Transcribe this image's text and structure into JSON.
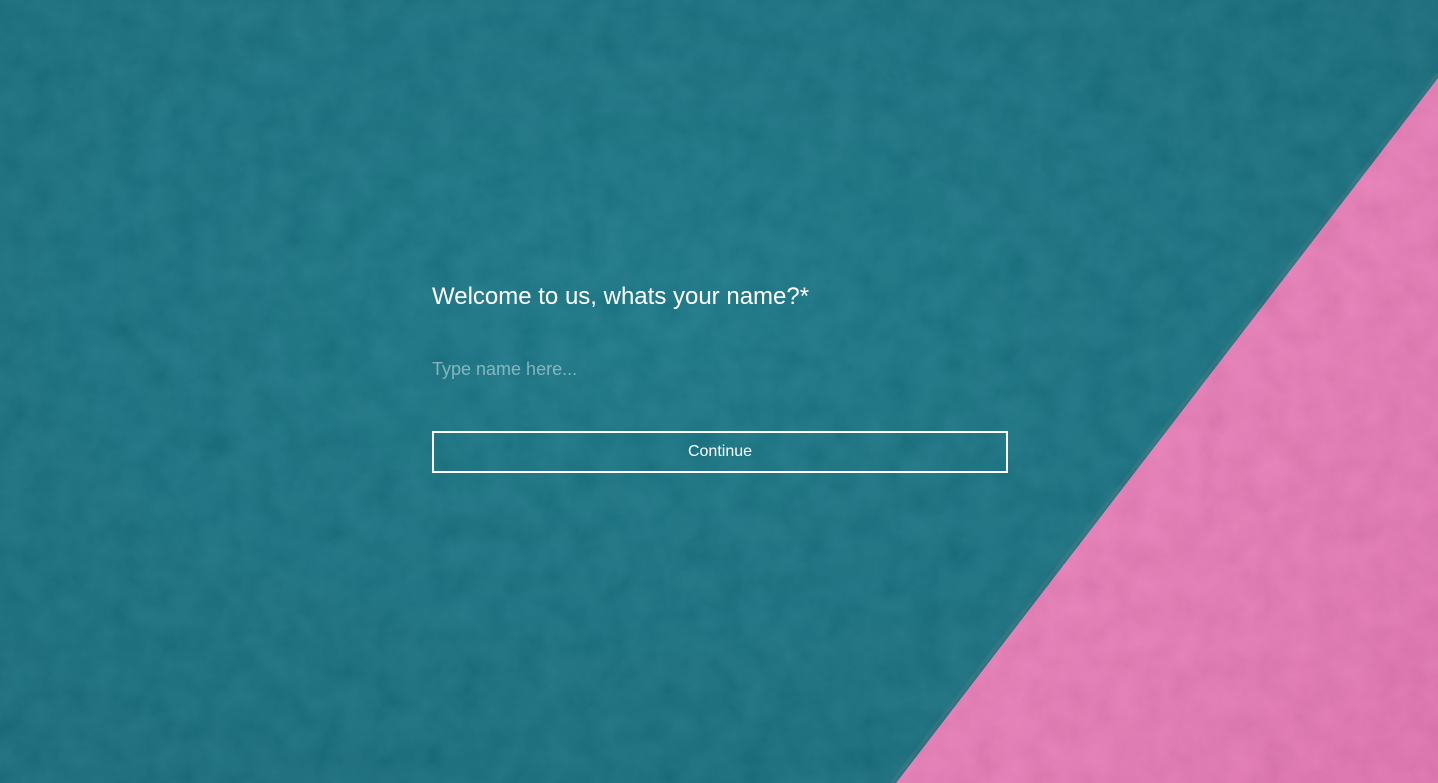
{
  "form": {
    "question": "Welcome to us, whats your name?*",
    "name_placeholder": "Type name here...",
    "name_value": "",
    "continue_label": "Continue"
  },
  "colors": {
    "teal_background": "#0e6e7e",
    "pink_stripe": "#ea78b8",
    "text": "#ffffff"
  }
}
